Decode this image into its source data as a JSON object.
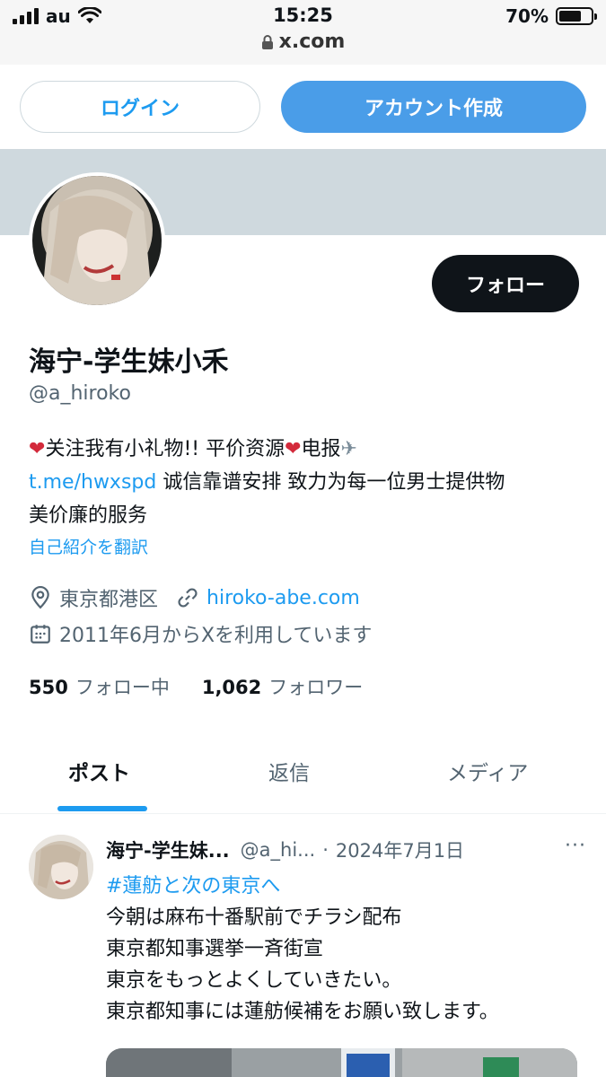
{
  "status_bar": {
    "carrier": "au",
    "time": "15:25",
    "battery_percent": "70%",
    "battery_level": 0.7,
    "url": "x.com"
  },
  "auth": {
    "login_label": "ログイン",
    "signup_label": "アカウント作成"
  },
  "profile": {
    "display_name": "海宁-学生妹小禾",
    "handle": "@a_hiroko",
    "follow_label": "フォロー",
    "bio_line1_text": "关注我有小礼物!! 平价资源",
    "bio_line1_tail": "电报",
    "bio_link": "t.me/hwxspd",
    "bio_line2_text": " 诚信靠谱安排 致力为每一位男士提供物",
    "bio_line3": "美价廉的服务",
    "translate_label": "自己紹介を翻訳",
    "location": "東京都港区",
    "website": "hiroko-abe.com",
    "joined": "2011年6月からXを利用しています",
    "following_count": "550",
    "following_label": "フォロー中",
    "followers_count": "1,062",
    "followers_label": "フォロワー"
  },
  "tabs": [
    {
      "label": "ポスト"
    },
    {
      "label": "返信"
    },
    {
      "label": "メディア"
    }
  ],
  "post": {
    "name": "海宁-学生妹...",
    "handle": "@a_hi...",
    "separator": "·",
    "date": "2024年7月1日",
    "more": "···",
    "hashtag": "#蓮舫と次の東京へ",
    "lines": [
      "今朝は麻布十番駅前でチラシ配布",
      "東京都知事選挙一斉街宣",
      "東京をもっとよくしていきたい。",
      "東京都知事には蓮舫候補をお願い致します。"
    ]
  },
  "colors": {
    "accent": "#1d9bf0",
    "banner": "#cfd9de",
    "follow_button": "#0f1419",
    "heart": "#d32a3b"
  },
  "icons": [
    "signal-icon",
    "wifi-icon",
    "battery-icon",
    "lock-icon",
    "location-icon",
    "link-icon",
    "calendar-icon",
    "heart-icon",
    "airplane-icon",
    "more-icon"
  ]
}
